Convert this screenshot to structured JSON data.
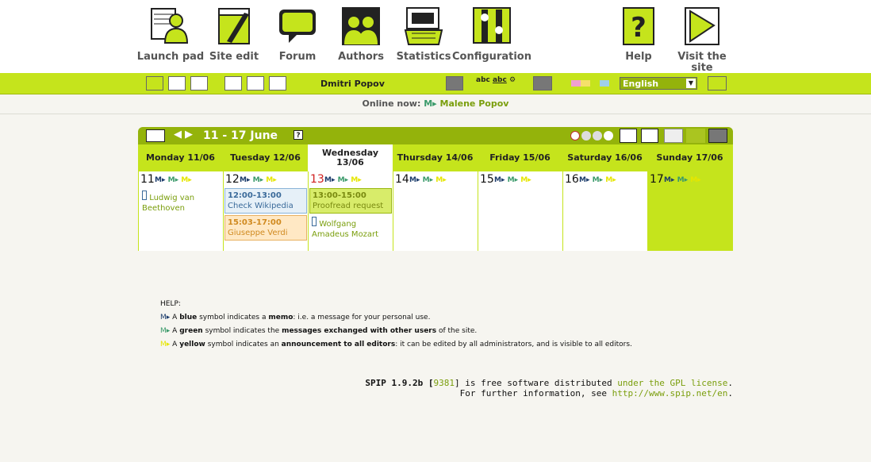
{
  "nav": {
    "launch_pad": "Launch pad",
    "site_edit": "Site edit",
    "forum": "Forum",
    "authors": "Authors",
    "statistics": "Statistics",
    "configuration": "Configuration",
    "help": "Help",
    "visit_site_1": "Visit the",
    "visit_site_2": "site"
  },
  "toolbar": {
    "user": "Dmitri Popov",
    "language": "English"
  },
  "online": {
    "label": "Online now:",
    "name": "Malene Popov"
  },
  "calendar": {
    "title": "11 - 17 June",
    "days": [
      {
        "name": "Monday 11/06",
        "num": "11"
      },
      {
        "name": "Tuesday 12/06",
        "num": "12"
      },
      {
        "name": "Wednesday 13/06",
        "num": "13"
      },
      {
        "name": "Thursday 14/06",
        "num": "14"
      },
      {
        "name": "Friday 15/06",
        "num": "15"
      },
      {
        "name": "Saturday 16/06",
        "num": "16"
      },
      {
        "name": "Sunday 17/06",
        "num": "17"
      }
    ],
    "events": {
      "mon_1": "Ludwig van Beethoven",
      "tue_1_time": "12:00-13:00",
      "tue_1_title": "Check Wikipedia",
      "tue_2_time": "15:03-17:00",
      "tue_2_title": "Giuseppe Verdi",
      "wed_1_time": "13:00-15:00",
      "wed_1_title": "Proofread request",
      "wed_2": "Wolfgang Amadeus Mozart"
    }
  },
  "help": {
    "title": "HELP:",
    "blue_a": "A ",
    "blue_b": "blue",
    "blue_c": " symbol indicates a ",
    "blue_d": "memo",
    "blue_e": ": i.e. a message for your personal use.",
    "green_a": "A ",
    "green_b": "green",
    "green_c": " symbol indicates the ",
    "green_d": "messages exchanged with other users",
    "green_e": " of the site.",
    "yellow_a": "A ",
    "yellow_b": "yellow",
    "yellow_c": " symbol indicates an ",
    "yellow_d": "announcement to all editors",
    "yellow_e": ": it can be edited by all administrators, and is visible to all editors."
  },
  "footer": {
    "line1_a": "SPIP 1.9.2b [",
    "line1_rev": "9381",
    "line1_b": "] is free software distributed ",
    "line1_link": "under the GPL license",
    "line1_c": ".",
    "line2_a": "For further information, see ",
    "line2_link": "http://www.spip.net/en",
    "line2_b": "."
  }
}
